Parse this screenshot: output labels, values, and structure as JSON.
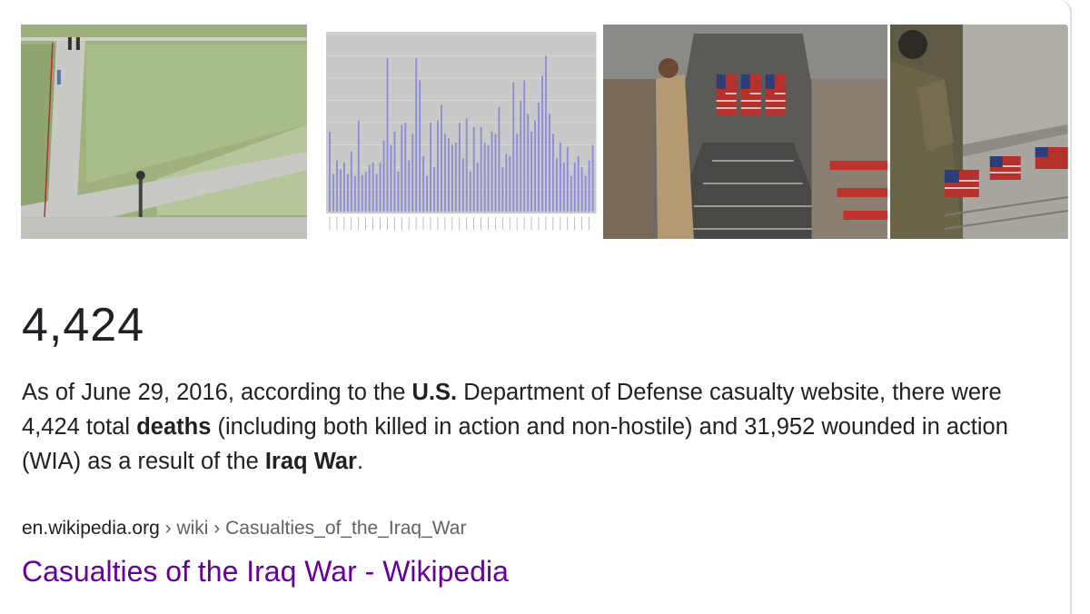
{
  "images": [
    {
      "name": "cemetery-aerial-photo"
    },
    {
      "name": "casualty-bar-chart-thumbnail",
      "chart_data": {
        "type": "bar",
        "values": [
          72,
          34,
          46,
          38,
          44,
          34,
          54,
          32,
          82,
          33,
          36,
          42,
          44,
          34,
          44,
          64,
          138,
          60,
          72,
          36,
          78,
          80,
          46,
          70,
          138,
          118,
          50,
          32,
          80,
          40,
          82,
          96,
          70,
          66,
          60,
          62,
          80,
          48,
          84,
          36,
          76,
          44,
          76,
          62,
          60,
          72,
          70,
          94,
          40,
          52,
          50,
          116,
          70,
          100,
          118,
          88,
          72,
          82,
          98,
          122,
          140,
          88,
          70,
          48,
          62,
          44,
          58,
          32,
          44,
          50,
          40,
          32,
          46,
          60
        ]
      }
    },
    {
      "name": "cargo-plane-honor-guard-photo"
    },
    {
      "name": "soldier-saluting-caskets-photo"
    }
  ],
  "answer": {
    "value": "4,424"
  },
  "description": {
    "part1": "As of June 29, 2016, according to the ",
    "bold1": "U.S.",
    "part2": " Department of Defense casualty website, there were 4,424 total ",
    "bold2": "deaths",
    "part3": " (including both killed in action and non-hostile) and 31,952 wounded in action (WIA) as a result of the ",
    "bold3": "Iraq War",
    "part4": "."
  },
  "source": {
    "domain": "en.wikipedia.org",
    "sep1": " › ",
    "crumb1": "wiki",
    "sep2": " › ",
    "crumb2": "Casualties_of_the_Iraq_War",
    "title": "Casualties of the Iraq War - Wikipedia"
  },
  "colors": {
    "link": "#660099",
    "text": "#202124",
    "muted": "#5f6368",
    "bars": "#8a8ad8"
  }
}
